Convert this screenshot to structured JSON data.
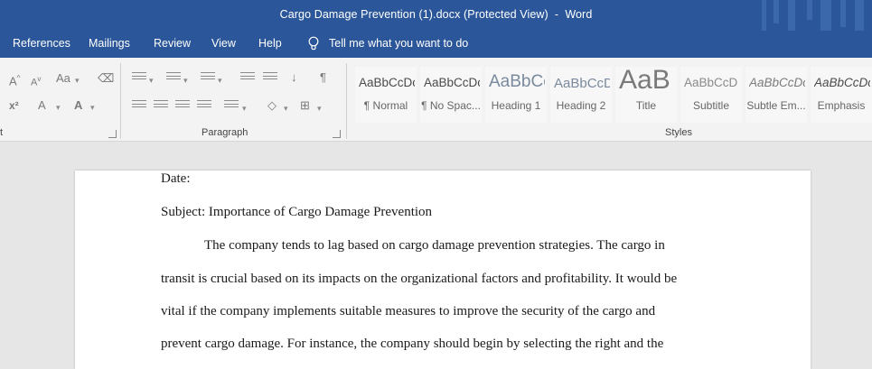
{
  "window": {
    "title": "Cargo Damage Prevention (1).docx (Protected View)  -  Word"
  },
  "menu": {
    "tabs": [
      "References",
      "Mailings",
      "Review",
      "View",
      "Help"
    ],
    "tell_me": "Tell me what you want to do"
  },
  "ribbon": {
    "groups": {
      "font_fragment": "t",
      "paragraph": "Paragraph",
      "styles": "Styles"
    },
    "font_icons": {
      "grow": "A",
      "shrink": "A",
      "change_case": "Aa",
      "superscript": "x²",
      "text_effects": "A",
      "font_color": "A"
    },
    "styles": [
      {
        "sample": "AaBbCcDc",
        "name": "¶ Normal"
      },
      {
        "sample": "AaBbCcDc",
        "name": "¶ No Spac..."
      },
      {
        "sample": "AaBbCc",
        "name": "Heading 1"
      },
      {
        "sample": "AaBbCcD",
        "name": "Heading 2"
      },
      {
        "sample": "AaB",
        "name": "Title"
      },
      {
        "sample": "AaBbCcD",
        "name": "Subtitle"
      },
      {
        "sample": "AaBbCcDc",
        "name": "Subtle Em..."
      },
      {
        "sample": "AaBbCcDc",
        "name": "Emphasis"
      }
    ]
  },
  "document": {
    "lines": [
      "Date:",
      "Subject: Importance of Cargo Damage Prevention",
      "The company tends to lag based on cargo damage prevention strategies. The cargo in",
      "transit is crucial based on its impacts on the organizational factors and profitability. It would be",
      "vital if the company implements suitable measures to improve the security of the cargo and",
      "prevent cargo damage. For instance, the company should begin by selecting the right and the"
    ]
  },
  "colors": {
    "title_bar": "#2b579a",
    "ribbon": "#f3f3f3",
    "canvas": "#e6e6e6"
  }
}
